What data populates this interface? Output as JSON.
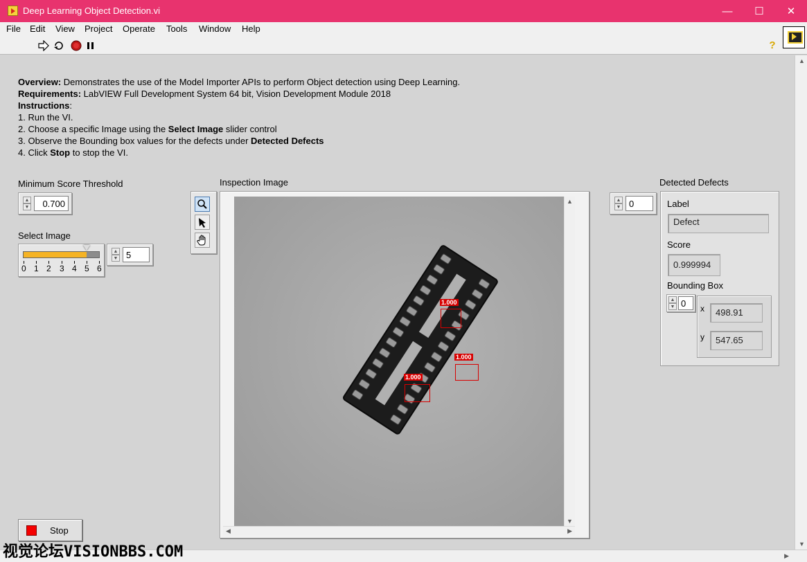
{
  "window": {
    "title": "Deep Learning Object Detection.vi",
    "minimize_glyph": "—",
    "maximize_glyph": "☐",
    "close_glyph": "✕"
  },
  "menu": [
    "File",
    "Edit",
    "View",
    "Project",
    "Operate",
    "Tools",
    "Window",
    "Help"
  ],
  "toolbar": {
    "run_icon": "run-arrow-icon",
    "run_continuous_icon": "run-continuously-icon",
    "abort_icon": "abort-execution-icon",
    "pause_icon": "pause-icon",
    "help_glyph": "?"
  },
  "overview": {
    "overview_label": "Overview:",
    "overview_text": " Demonstrates the use of the Model Importer APIs to perform Object detection using Deep Learning.",
    "requirements_label": "Requirements:",
    "requirements_text": " LabVIEW Full Development System 64 bit, Vision Development Module 2018",
    "instructions_label": "Instructions",
    "instructions_colon": ":",
    "step1": "1. Run the VI.",
    "step2_a": "2. Choose a specific Image using the ",
    "step2_b": "Select Image",
    "step2_c": " slider control",
    "step3_a": "3. Observe the Bounding box values for the defects under ",
    "step3_b": "Detected Defects",
    "step4_a": "4. Click ",
    "step4_b": "Stop",
    "step4_c": " to stop the VI."
  },
  "min_score": {
    "label": "Minimum Score Threshold",
    "value": "0.700"
  },
  "select_image": {
    "label": "Select Image",
    "ticks": [
      "0",
      "1",
      "2",
      "3",
      "4",
      "5",
      "6"
    ],
    "slider_value": 5,
    "slider_max": 6,
    "numeric_value": "5",
    "fill_color": "#f5b324"
  },
  "inspection": {
    "label": "Inspection Image",
    "detections": [
      {
        "score": "1.000"
      },
      {
        "score": "1.000"
      },
      {
        "score": "1.000"
      }
    ]
  },
  "defects": {
    "label": "Detected Defects",
    "index": "0",
    "label_caption": "Label",
    "label_value": "Defect",
    "score_caption": "Score",
    "score_value": "0.999994",
    "bbox_caption": "Bounding Box",
    "bbox_index": "0",
    "x_caption": "x",
    "x_value": "498.91",
    "y_caption": "y",
    "y_value": "547.65"
  },
  "stop": {
    "label": "Stop"
  },
  "watermark": "视觉论坛VISIONBBS.COM"
}
